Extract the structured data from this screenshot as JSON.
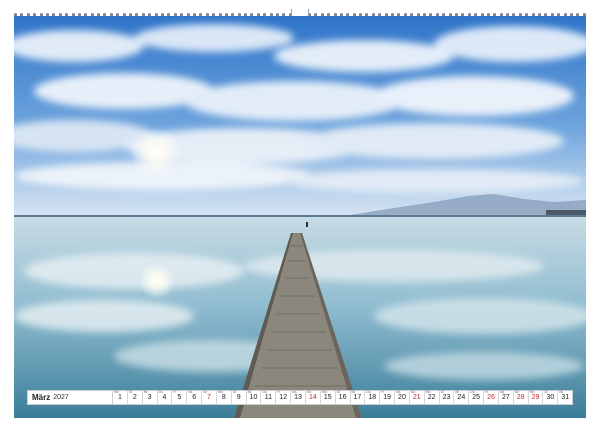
{
  "calendar": {
    "month": "März",
    "year": "2027",
    "days": [
      {
        "n": "1",
        "wd": "Mo",
        "red": false
      },
      {
        "n": "2",
        "wd": "Di",
        "red": false
      },
      {
        "n": "3",
        "wd": "Mi",
        "red": false
      },
      {
        "n": "4",
        "wd": "Do",
        "red": false
      },
      {
        "n": "5",
        "wd": "Fr",
        "red": false
      },
      {
        "n": "6",
        "wd": "Sa",
        "red": false
      },
      {
        "n": "7",
        "wd": "So",
        "red": true
      },
      {
        "n": "8",
        "wd": "Mo",
        "red": false
      },
      {
        "n": "9",
        "wd": "Di",
        "red": false
      },
      {
        "n": "10",
        "wd": "Mi",
        "red": false
      },
      {
        "n": "11",
        "wd": "Do",
        "red": false
      },
      {
        "n": "12",
        "wd": "Fr",
        "red": false
      },
      {
        "n": "13",
        "wd": "Sa",
        "red": false
      },
      {
        "n": "14",
        "wd": "So",
        "red": true
      },
      {
        "n": "15",
        "wd": "Mo",
        "red": false
      },
      {
        "n": "16",
        "wd": "Di",
        "red": false
      },
      {
        "n": "17",
        "wd": "Mi",
        "red": false
      },
      {
        "n": "18",
        "wd": "Do",
        "red": false
      },
      {
        "n": "19",
        "wd": "Fr",
        "red": false
      },
      {
        "n": "20",
        "wd": "Sa",
        "red": false
      },
      {
        "n": "21",
        "wd": "So",
        "red": true
      },
      {
        "n": "22",
        "wd": "Mo",
        "red": false
      },
      {
        "n": "23",
        "wd": "Di",
        "red": false
      },
      {
        "n": "24",
        "wd": "Mi",
        "red": false
      },
      {
        "n": "25",
        "wd": "Do",
        "red": false
      },
      {
        "n": "26",
        "wd": "Fr",
        "red": true
      },
      {
        "n": "27",
        "wd": "Sa",
        "red": false
      },
      {
        "n": "28",
        "wd": "So",
        "red": true
      },
      {
        "n": "29",
        "wd": "Mo",
        "red": true
      },
      {
        "n": "30",
        "wd": "Di",
        "red": false
      },
      {
        "n": "31",
        "wd": "Mi",
        "red": false
      }
    ]
  },
  "colors": {
    "sky_top": "#2f74c9",
    "sky_horizon": "#cfdff0",
    "water_top": "#b9d3de",
    "water_bottom": "#2f6f8c",
    "pier": "#7d7a72",
    "sunday_red": "#c62828"
  }
}
